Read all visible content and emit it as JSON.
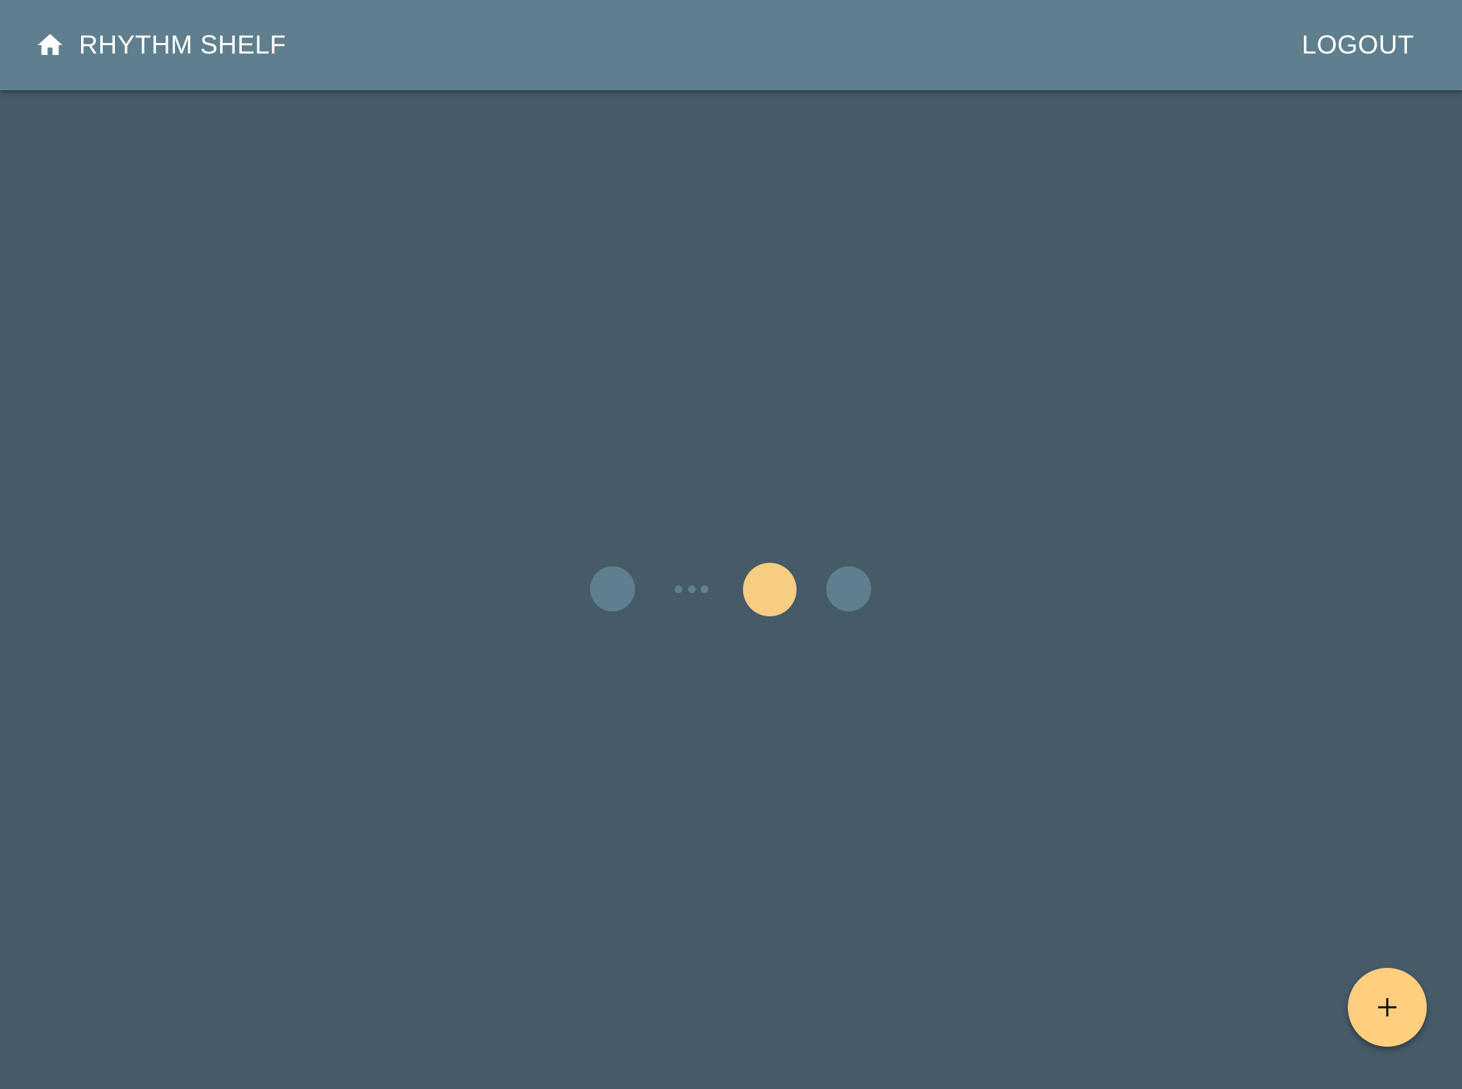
{
  "header": {
    "home_icon": "home-icon",
    "title": "RHYTHM SHELF",
    "logout_label": "LOGOUT"
  },
  "stepper": {
    "total_visible_steps": 3,
    "active_step_position": 2,
    "has_collapsed_steps": true
  },
  "fab": {
    "icon": "plus-icon"
  },
  "colors": {
    "header_background": "#5f7f8e",
    "page_background": "#465a67",
    "accent": "#f6cd83",
    "fab_background": "#ffcf7f",
    "inactive_step": "#5f7f8e"
  }
}
